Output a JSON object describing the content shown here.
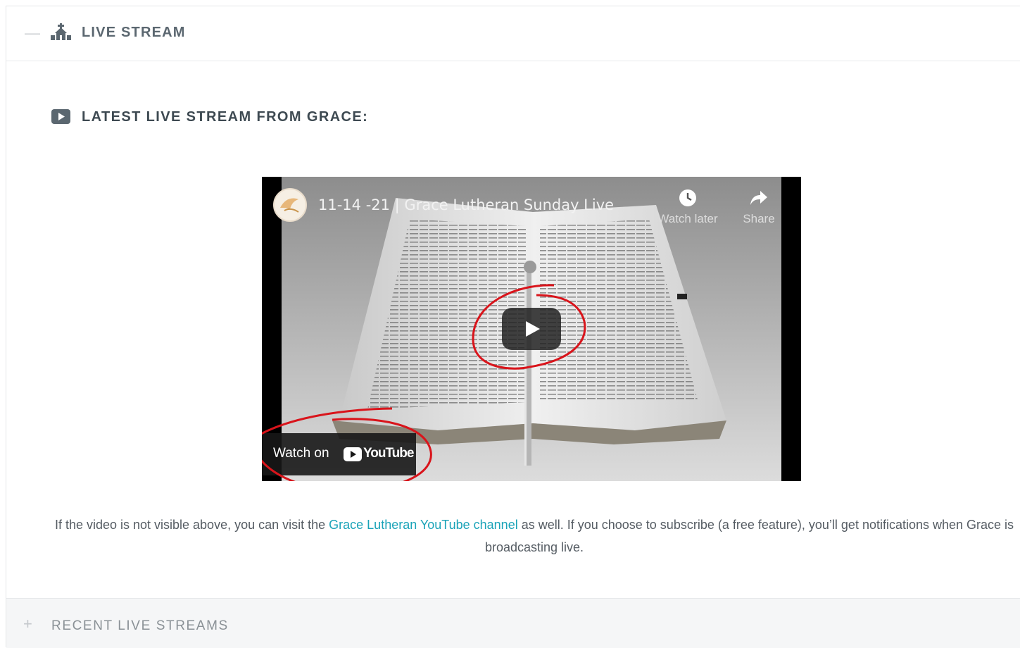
{
  "accordion_main": {
    "toggle": "—",
    "title": "LIVE STREAM",
    "icon": "church-icon"
  },
  "section": {
    "icon": "video-play-icon",
    "heading": "LATEST LIVE STREAM FROM GRACE:"
  },
  "video": {
    "title": "11-14 -21 | Grace Lutheran Sunday Live",
    "watch_later": "Watch later",
    "share": "Share",
    "watch_on": "Watch on",
    "youtube": "YouTube"
  },
  "caption": {
    "before_link": "If the video is not visible above, you can visit the ",
    "link_text": "Grace Lutheran YouTube channel",
    "after_link": " as well.  If you choose to subscribe (a free feature), you’ll get notifications when Grace is broadcasting live."
  },
  "accordion_secondary": {
    "toggle": "+",
    "title": "RECENT LIVE STREAMS"
  },
  "colors": {
    "link": "#1aa3b8",
    "annotation": "#d9141b",
    "heading": "#3e4a52"
  }
}
